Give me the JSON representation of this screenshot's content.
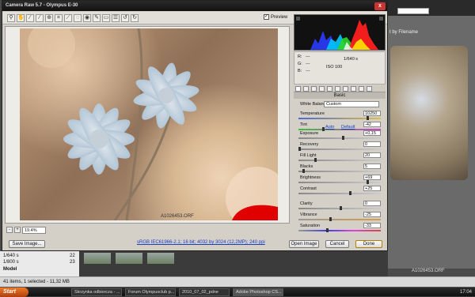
{
  "dialog": {
    "title": "Camera Raw 5.7  -  Olympus E-30",
    "close_label": "x",
    "preview_label": "Preview",
    "preview_checked": "✓"
  },
  "toolbar": {
    "tools": [
      "zoom-icon",
      "hand-icon",
      "white-balance-icon",
      "color-sampler-icon",
      "target-adjust-icon",
      "crop-icon",
      "straighten-icon",
      "spot-removal-icon",
      "red-eye-icon",
      "adjustment-brush-icon",
      "graduated-filter-icon",
      "preferences-icon",
      "rotate-left-icon",
      "rotate-right-icon"
    ]
  },
  "image": {
    "filename": "A1026453.ORF"
  },
  "zoom": {
    "minus": "-",
    "plus": "+",
    "level": "19.4%"
  },
  "bottom": {
    "save_image": "Save Image...",
    "workflow": "sRGB IEC61966-2.1; 16 bit; 4032 by 3024 (12,2MP); 240 ppi",
    "open_image": "Open Image",
    "cancel": "Cancel",
    "done": "Done"
  },
  "info": {
    "r_label": "R:",
    "g_label": "G:",
    "b_label": "B:",
    "r": "---",
    "g": "---",
    "b": "---",
    "shutter": "1/640 s",
    "iso": "ISO 100"
  },
  "panel": {
    "section": "Basic",
    "wb_label": "White Balance:",
    "wb_value": "Custom",
    "temperature_label": "Temperature",
    "temperature": "10250",
    "tint_label": "Tint",
    "tint": "-42",
    "auto_label": "Auto",
    "default_label": "Default",
    "exposure_label": "Exposure",
    "exposure": "+0,15",
    "recovery_label": "Recovery",
    "recovery": "0",
    "filllight_label": "Fill Light",
    "filllight": "20",
    "blacks_label": "Blacks",
    "blacks": "5",
    "brightness_label": "Brightness",
    "brightness": "+69",
    "contrast_label": "Contrast",
    "contrast": "+25",
    "clarity_label": "Clarity",
    "clarity": "0",
    "vibrance_label": "Vibrance",
    "vibrance": "-25",
    "saturation_label": "Saturation",
    "saturation": "-33"
  },
  "bridge": {
    "sort_label": "t by Filename",
    "preview_name": "A1026453.ORF",
    "status": "41 items, 1 selected - 11,32 MB",
    "rows": [
      {
        "a": "1/640 s",
        "b": "22"
      },
      {
        "a": "1/800 s",
        "b": "23"
      }
    ],
    "model_label": "Model"
  },
  "taskbar": {
    "start": "Start",
    "tasks": [
      "Skrzynka odbiorcza - ...",
      "Forum Olympusclub p...",
      "2010_07_02_pdne",
      "Adobe Photoshop CS..."
    ],
    "clock": "17:04"
  }
}
